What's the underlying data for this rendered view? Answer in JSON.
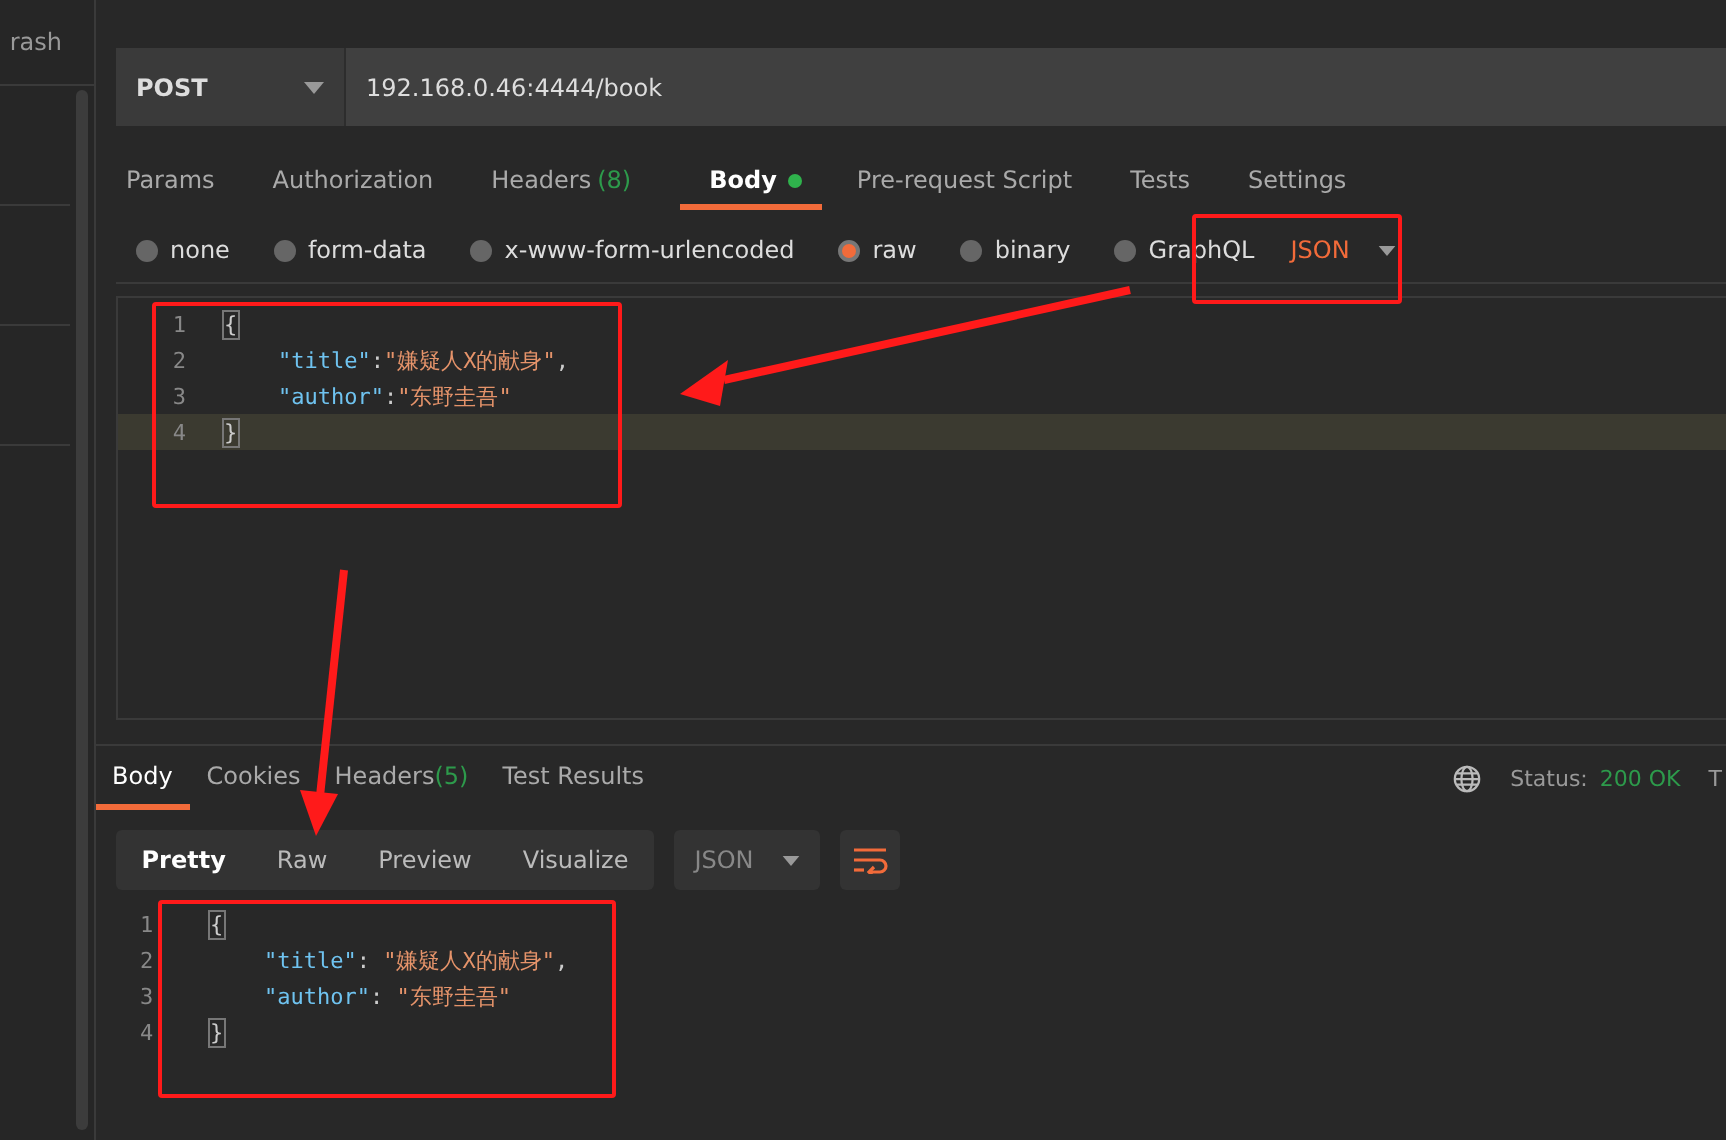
{
  "sidebar": {
    "items": [
      "rash"
    ]
  },
  "request": {
    "method": "POST",
    "url": "192.168.0.46:4444/book"
  },
  "request_tabs": [
    {
      "label": "Params",
      "selected": false
    },
    {
      "label": "Authorization",
      "selected": false
    },
    {
      "label": "Headers",
      "count": "(8)",
      "selected": false
    },
    {
      "label": "Body",
      "selected": true,
      "dot": true
    },
    {
      "label": "Pre-request Script",
      "selected": false
    },
    {
      "label": "Tests",
      "selected": false
    },
    {
      "label": "Settings",
      "selected": false
    }
  ],
  "body_types": [
    {
      "label": "none",
      "selected": false
    },
    {
      "label": "form-data",
      "selected": false
    },
    {
      "label": "x-www-form-urlencoded",
      "selected": false
    },
    {
      "label": "raw",
      "selected": true
    },
    {
      "label": "binary",
      "selected": false
    },
    {
      "label": "GraphQL",
      "selected": false
    }
  ],
  "body_format": "JSON",
  "request_body": [
    {
      "number": "1",
      "tokens": [
        {
          "kind": "bracket",
          "text": "{"
        }
      ]
    },
    {
      "number": "2",
      "tokens": [
        {
          "kind": "key",
          "text": "\"title\""
        },
        {
          "kind": "punct",
          "text": ":"
        },
        {
          "kind": "string",
          "text": "\"嫌疑人X的献身\""
        },
        {
          "kind": "punct",
          "text": ","
        }
      ]
    },
    {
      "number": "3",
      "tokens": [
        {
          "kind": "key",
          "text": "\"author\""
        },
        {
          "kind": "punct",
          "text": ":"
        },
        {
          "kind": "string",
          "text": "\"东野圭吾\""
        }
      ]
    },
    {
      "number": "4",
      "tokens": [
        {
          "kind": "bracket",
          "text": "}"
        }
      ],
      "highlighted": true
    }
  ],
  "response_tabs": [
    {
      "label": "Body",
      "selected": true
    },
    {
      "label": "Cookies",
      "selected": false
    },
    {
      "label": "Headers",
      "count": "(5)",
      "selected": false
    },
    {
      "label": "Test Results",
      "selected": false
    }
  ],
  "status": {
    "label": "Status:",
    "value": "200 OK",
    "next": "T"
  },
  "view_modes": [
    {
      "label": "Pretty",
      "selected": true
    },
    {
      "label": "Raw",
      "selected": false
    },
    {
      "label": "Preview",
      "selected": false
    },
    {
      "label": "Visualize",
      "selected": false
    }
  ],
  "response_format": "JSON",
  "response_body": [
    {
      "number": "1",
      "tokens": [
        {
          "kind": "bracket",
          "text": "{"
        }
      ]
    },
    {
      "number": "2",
      "tokens": [
        {
          "kind": "key",
          "text": "\"title\""
        },
        {
          "kind": "punct",
          "text": ": "
        },
        {
          "kind": "string",
          "text": "\"嫌疑人X的献身\""
        },
        {
          "kind": "punct",
          "text": ","
        }
      ]
    },
    {
      "number": "3",
      "tokens": [
        {
          "kind": "key",
          "text": "\"author\""
        },
        {
          "kind": "punct",
          "text": ": "
        },
        {
          "kind": "string",
          "text": "\"东野圭吾\""
        }
      ]
    },
    {
      "number": "4",
      "tokens": [
        {
          "kind": "bracket",
          "text": "}"
        }
      ]
    }
  ]
}
